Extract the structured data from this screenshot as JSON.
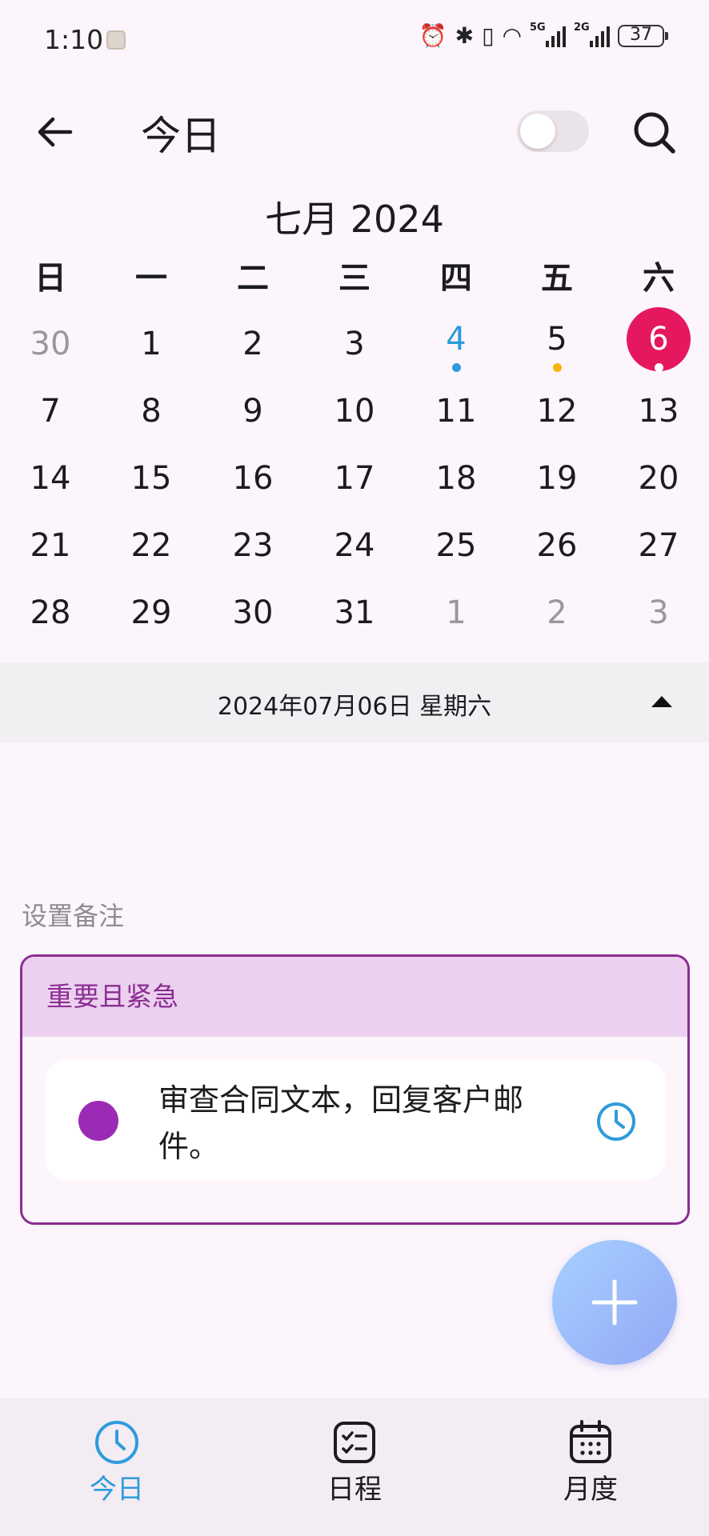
{
  "status_bar": {
    "time": "1:10",
    "network_5g": "5G",
    "network_2g": "2G",
    "battery": "37"
  },
  "header": {
    "title": "今日"
  },
  "calendar": {
    "month_title": "七月 2024",
    "weekdays": [
      "日",
      "一",
      "二",
      "三",
      "四",
      "五",
      "六"
    ],
    "weeks": [
      [
        "30",
        "1",
        "2",
        "3",
        "4",
        "5",
        "6"
      ],
      [
        "7",
        "8",
        "9",
        "10",
        "11",
        "12",
        "13"
      ],
      [
        "14",
        "15",
        "16",
        "17",
        "18",
        "19",
        "20"
      ],
      [
        "21",
        "22",
        "23",
        "24",
        "25",
        "26",
        "27"
      ],
      [
        "28",
        "29",
        "30",
        "31",
        "1",
        "2",
        "3"
      ]
    ],
    "selected_day": "6",
    "colors": {
      "selected": "#e5185f",
      "today_text": "#2e9bdc",
      "event_dot_blue": "#2e9bdc",
      "event_dot_orange": "#f5b50a",
      "muted": "#9a979c"
    }
  },
  "date_bar": {
    "text": "2024年07月06日  星期六"
  },
  "note_label": "设置备注",
  "category": {
    "title": "重要且紧急",
    "color": "#8b2d92",
    "tasks": [
      {
        "text": "审查合同文本，回复客户邮件。",
        "dot_color": "#9b2bb4"
      }
    ]
  },
  "bottom_nav": {
    "items": [
      {
        "label": "今日",
        "icon": "clock-icon",
        "active": true
      },
      {
        "label": "日程",
        "icon": "checklist-icon",
        "active": false
      },
      {
        "label": "月度",
        "icon": "calendar-icon",
        "active": false
      }
    ]
  }
}
